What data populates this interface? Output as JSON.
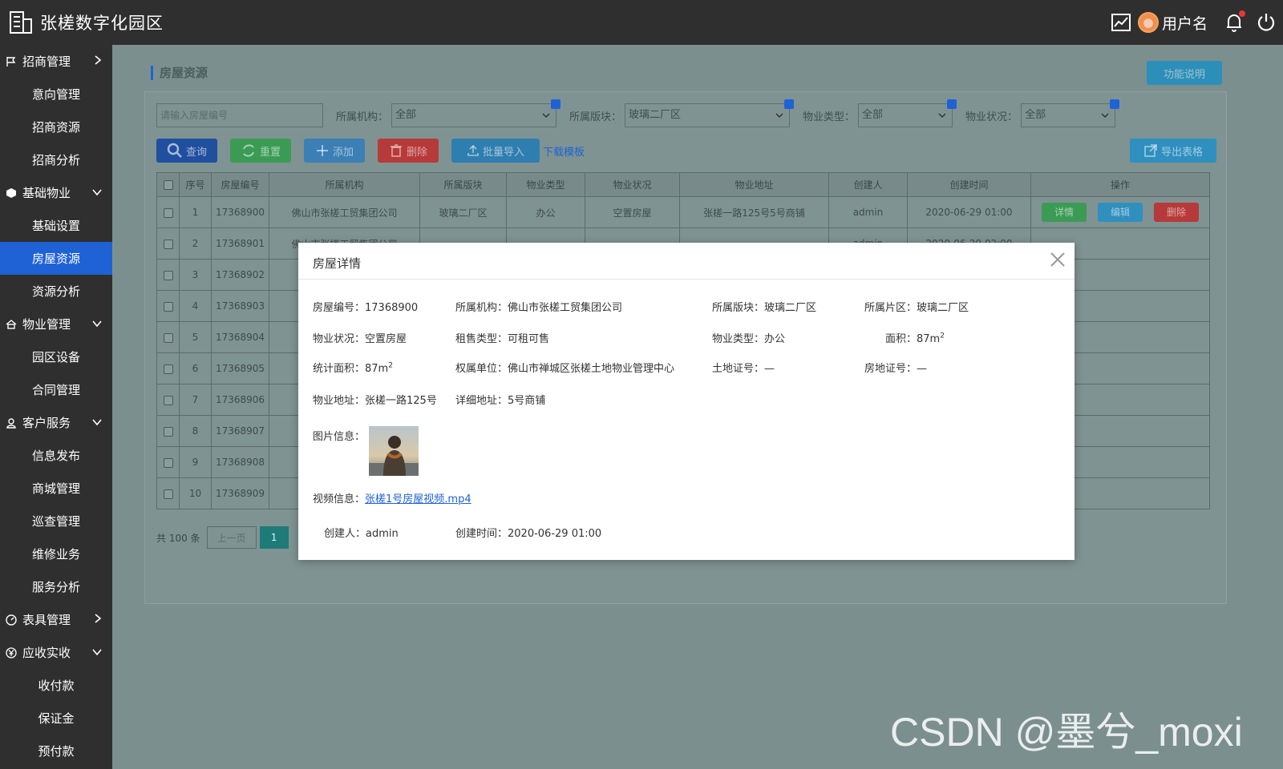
{
  "app": {
    "title": "张槎数字化园区",
    "username": "用户名"
  },
  "colors": {
    "accent": "#1f62d6",
    "sidebar": "#2f2f2f",
    "success": "#3b9b55",
    "danger": "#b73a3a",
    "info": "#2f8fbf"
  },
  "sidebar": {
    "items": [
      {
        "label": "招商管理",
        "type": "group",
        "icon": "flag-icon",
        "chevron": "right"
      },
      {
        "label": "意向管理",
        "type": "item"
      },
      {
        "label": "招商资源",
        "type": "item"
      },
      {
        "label": "招商分析",
        "type": "item"
      },
      {
        "label": "基础物业",
        "type": "group",
        "icon": "cube-icon",
        "chevron": "down"
      },
      {
        "label": "基础设置",
        "type": "item"
      },
      {
        "label": "房屋资源",
        "type": "item",
        "active": true
      },
      {
        "label": "资源分析",
        "type": "item"
      },
      {
        "label": "物业管理",
        "type": "group",
        "icon": "home-icon",
        "chevron": "down"
      },
      {
        "label": "园区设备",
        "type": "item"
      },
      {
        "label": "合同管理",
        "type": "item"
      },
      {
        "label": "客户服务",
        "type": "group",
        "icon": "user-icon",
        "chevron": "down"
      },
      {
        "label": "信息发布",
        "type": "item"
      },
      {
        "label": "商城管理",
        "type": "item"
      },
      {
        "label": "巡查管理",
        "type": "item"
      },
      {
        "label": "维修业务",
        "type": "item"
      },
      {
        "label": "服务分析",
        "type": "item"
      },
      {
        "label": "表具管理",
        "type": "group",
        "icon": "meter-icon",
        "chevron": "right"
      },
      {
        "label": "应收实收",
        "type": "group",
        "icon": "yen-icon",
        "chevron": "down"
      },
      {
        "label": "收付款",
        "type": "item"
      },
      {
        "label": "保证金",
        "type": "item"
      },
      {
        "label": "预付款",
        "type": "item"
      }
    ]
  },
  "page": {
    "title": "房屋资源",
    "help_label": "功能说明"
  },
  "filters": {
    "search_placeholder": "请输入房屋编号",
    "org_label": "所属机构：",
    "org_value": "全部",
    "block_label": "所属版块：",
    "block_value": "玻璃二厂区",
    "ptype_label": "物业类型：",
    "ptype_value": "全部",
    "pstatus_label": "物业状况：",
    "pstatus_value": "全部"
  },
  "toolbar": {
    "query": "查询",
    "reset": "重置",
    "add": "添加",
    "delete": "删除",
    "import": "批量导入",
    "template": "下载模板",
    "export": "导出表格"
  },
  "table": {
    "headers": [
      "序号",
      "房屋编号",
      "所属机构",
      "所属版块",
      "物业类型",
      "物业状况",
      "物业地址",
      "创建人",
      "创建时间",
      "操作"
    ],
    "rows": [
      {
        "no": "1",
        "code": "17368900",
        "org": "佛山市张槎工贸集团公司",
        "block": "玻璃二厂区",
        "ptype": "办公",
        "pstatus": "空置房屋",
        "addr": "张槎一路125号5号商铺",
        "creator": "admin",
        "time": "2020-06-29  01:00"
      },
      {
        "no": "2",
        "code": "17368901",
        "org": "佛山市张槎工贸集团公司",
        "block": "",
        "ptype": "",
        "pstatus": "",
        "addr": "",
        "creator": "admin",
        "time": "2020-06-29  02:00"
      },
      {
        "no": "3",
        "code": "17368902",
        "org": "佛山",
        "block": "",
        "ptype": "",
        "pstatus": "",
        "addr": "",
        "creator": "",
        "time": ""
      },
      {
        "no": "4",
        "code": "17368903",
        "org": "佛山",
        "block": "",
        "ptype": "",
        "pstatus": "",
        "addr": "",
        "creator": "",
        "time": ""
      },
      {
        "no": "5",
        "code": "17368904",
        "org": "佛山",
        "block": "",
        "ptype": "",
        "pstatus": "",
        "addr": "",
        "creator": "",
        "time": ""
      },
      {
        "no": "6",
        "code": "17368905",
        "org": "佛山",
        "block": "",
        "ptype": "",
        "pstatus": "",
        "addr": "",
        "creator": "",
        "time": ""
      },
      {
        "no": "7",
        "code": "17368906",
        "org": "佛山",
        "block": "",
        "ptype": "",
        "pstatus": "",
        "addr": "",
        "creator": "",
        "time": ""
      },
      {
        "no": "8",
        "code": "17368907",
        "org": "佛山",
        "block": "",
        "ptype": "",
        "pstatus": "",
        "addr": "",
        "creator": "",
        "time": ""
      },
      {
        "no": "9",
        "code": "17368908",
        "org": "佛山",
        "block": "",
        "ptype": "",
        "pstatus": "",
        "addr": "",
        "creator": "",
        "time": ""
      },
      {
        "no": "10",
        "code": "17368909",
        "org": "佛山",
        "block": "",
        "ptype": "",
        "pstatus": "",
        "addr": "",
        "creator": "",
        "time": ""
      }
    ],
    "actions": {
      "detail": "详情",
      "edit": "编辑",
      "delete": "删除"
    }
  },
  "pager": {
    "total": "共 100 条",
    "prev": "上一页",
    "current": "1"
  },
  "modal": {
    "title": "房屋详情",
    "fields": {
      "code_k": "房屋编号：",
      "code_v": "17368900",
      "org_k": "所属机构：",
      "org_v": "佛山市张槎工贸集团公司",
      "block_k": "所属版块：",
      "block_v": "玻璃二厂区",
      "area_k": "所属片区：",
      "area_v": "玻璃二厂区",
      "status_k": "物业状况：",
      "status_v": "空置房屋",
      "rent_k": "租售类型：",
      "rent_v": "可租可售",
      "ptype_k": "物业类型：",
      "ptype_v": "办公",
      "size_k": "面积：",
      "size_v": "87m",
      "size_sup": "2",
      "stat_k": "统计面积：",
      "stat_v": "87m",
      "stat_sup": "2",
      "owner_k": "权属单位：",
      "owner_v": "佛山市禅城区张槎土地物业管理中心",
      "land_k": "土地证号：",
      "land_v": "—",
      "estate_k": "房地证号：",
      "estate_v": "—",
      "addr_k": "物业地址：",
      "addr_v": "张槎一路125号",
      "detail_k": "详细地址：",
      "detail_v": "5号商铺",
      "image_k": "图片信息：",
      "video_k": "视频信息：",
      "video_v": "张槎1号房屋视频.mp4",
      "creator_k": "创建人：",
      "creator_v": "admin",
      "ctime_k": "创建时间：",
      "ctime_v": "2020-06-29  01:00"
    }
  },
  "watermark": "CSDN @墨兮_moxi"
}
